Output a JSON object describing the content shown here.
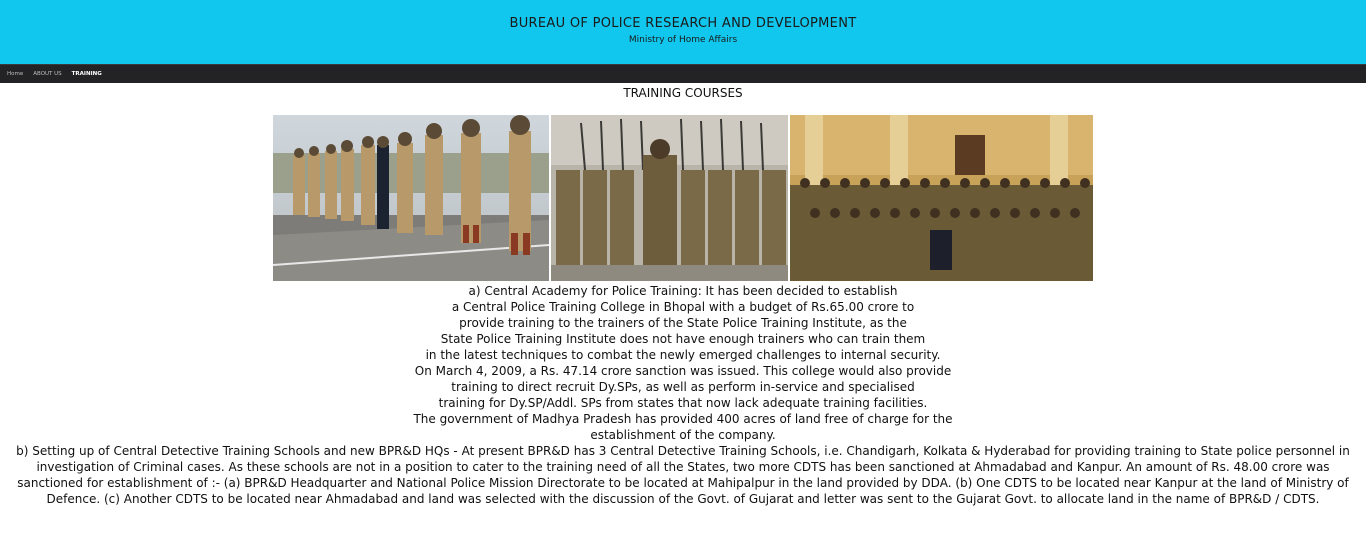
{
  "header": {
    "title": "BUREAU OF POLICE RESEARCH AND DEVELOPMENT",
    "subtitle": "Ministry of Home Affairs"
  },
  "nav": {
    "items": [
      {
        "label": "Home"
      },
      {
        "label": "ABOUT US"
      },
      {
        "label": "TRAINING"
      }
    ]
  },
  "main": {
    "page_title": "TRAINING COURSES",
    "para_a_lines": [
      "a) Central Academy for Police Training: It has been decided to establish",
      "a Central Police Training College in Bhopal with a budget of Rs.65.00 crore to",
      "provide training to the trainers of the State Police Training Institute, as the",
      "State Police Training Institute does not have enough trainers who can train them",
      "in the latest techniques to combat the newly emerged challenges to internal security.",
      "On March 4, 2009, a Rs. 47.14 crore sanction was issued. This college would also provide",
      "training to direct recruit Dy.SPs, as well as perform in-service and specialised",
      "training for Dy.SP/Addl. SPs from states that now lack adequate training facilities.",
      "The government of Madhya Pradesh has provided 400 acres of land free of charge for the",
      "establishment of the company."
    ],
    "para_b": "b) Setting up of Central Detective Training Schools and new BPR&D HQs - At present BPR&D has 3 Central Detective Training Schools, i.e. Chandigarh, Kolkata & Hyderabad for providing training to State police personnel in investigation of Criminal cases. As these schools are not in a position to cater to the training need of all the States, two more CDTS has been sanctioned at Ahmadabad and Kanpur. An amount of Rs. 48.00 crore was sanctioned for establishment of :- (a) BPR&D Headquarter and National Police Mission Directorate to be located at Mahipalpur in the land provided by DDA. (b) One CDTS to be located near Kanpur at the land of Ministry of Defence. (c) Another CDTS to be located near Ahmadabad and land was selected with the discussion of the Govt. of Gujarat and letter was sent to the Gujarat Govt. to allocate land in the name of BPR&D / CDTS."
  },
  "colors": {
    "header_bg": "#11c7ee",
    "nav_bg": "#232326"
  },
  "images": [
    {
      "name": "police-officers-line-photo"
    },
    {
      "name": "police-parade-photo"
    },
    {
      "name": "group-photo"
    }
  ]
}
